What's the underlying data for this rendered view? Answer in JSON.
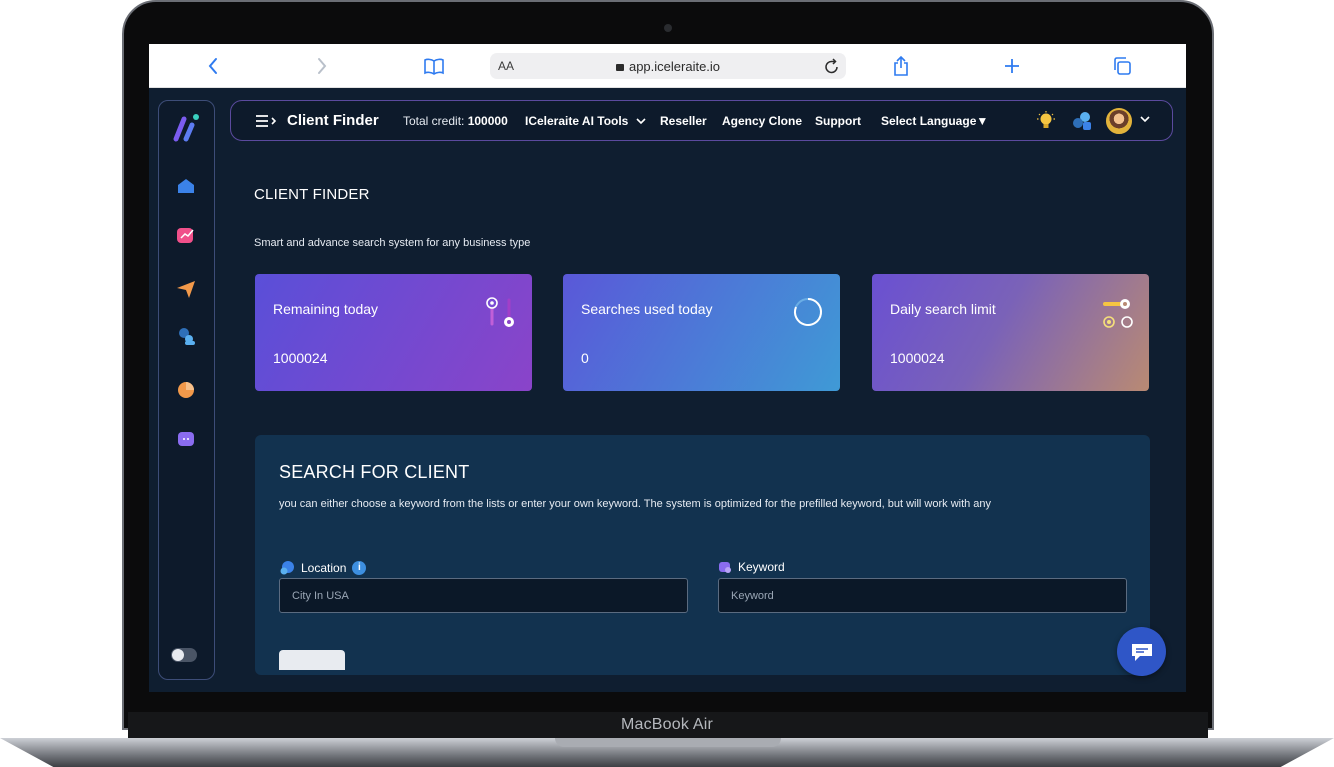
{
  "device": {
    "label": "MacBook Air"
  },
  "browser": {
    "text_size_label": "AA",
    "url": "app.iceleraite.io"
  },
  "sidebar": {
    "items": [
      {
        "icon": "home-icon"
      },
      {
        "icon": "analytics-icon"
      },
      {
        "icon": "send-icon"
      },
      {
        "icon": "users-icon"
      },
      {
        "icon": "chart-pie-icon"
      },
      {
        "icon": "chat-icon"
      }
    ]
  },
  "nav": {
    "title": "Client Finder",
    "credit_label": "Total credit:",
    "credit_value": "100000",
    "tools_label": "ICeleraite AI Tools",
    "reseller_label": "Reseller",
    "agency_clone_label": "Agency Clone",
    "support_label": "Support",
    "language_label": "Select Language"
  },
  "page": {
    "title": "CLIENT FINDER",
    "subtitle": "Smart and advance search system for any business type"
  },
  "stats": [
    {
      "label": "Remaining today",
      "value": "1000024"
    },
    {
      "label": "Searches used today",
      "value": "0"
    },
    {
      "label": "Daily search limit",
      "value": "1000024"
    }
  ],
  "search": {
    "title": "SEARCH FOR CLIENT",
    "description": "you can either choose a keyword from the lists or enter your own keyword. The system is optimized for the prefilled keyword, but will work with any",
    "location_label": "Location",
    "location_placeholder": "City In USA",
    "keyword_label": "Keyword",
    "keyword_placeholder": "Keyword"
  },
  "colors": {
    "accent": "#5b4a9e",
    "screen_bg": "#0f1e30",
    "panel_bg": "#12324f",
    "chat": "#2f56c7"
  }
}
